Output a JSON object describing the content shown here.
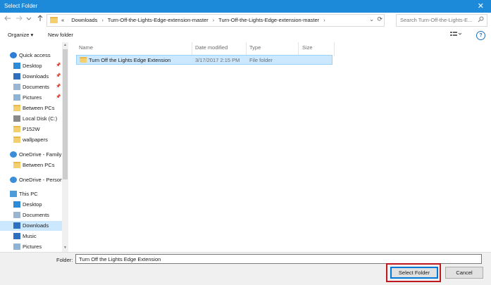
{
  "window": {
    "title": "Select Folder",
    "close_glyph": "✕"
  },
  "nav": {
    "back_icon": "arrow-left-icon",
    "forward_icon": "arrow-right-icon",
    "recent_icon": "chevron-down-icon",
    "up_icon": "arrow-up-icon"
  },
  "address": {
    "overflow": "«",
    "crumbs": [
      "Downloads",
      "Turn-Off-the-Lights-Edge-extension-master",
      "Turn-Off-the-Lights-Edge-extension-master"
    ],
    "separator": "›"
  },
  "search": {
    "placeholder": "Search Turn-Off-the-Lights-E..."
  },
  "toolbar": {
    "organize": "Organize ▾",
    "new_folder": "New folder",
    "view_icon": "view-options-icon",
    "help": "?"
  },
  "sidebar": {
    "items": [
      {
        "label": "Quick access",
        "icon": "star-icon",
        "color": "#2c7ed6",
        "pinned": false
      },
      {
        "label": "Desktop",
        "icon": "desktop-icon",
        "color": "#2e8bd7",
        "pinned": true
      },
      {
        "label": "Downloads",
        "icon": "download-icon",
        "color": "#2e6fc0",
        "pinned": true
      },
      {
        "label": "Documents",
        "icon": "documents-icon",
        "color": "#9bb5d0",
        "pinned": true
      },
      {
        "label": "Pictures",
        "icon": "pictures-icon",
        "color": "#8fb3d3",
        "pinned": true
      },
      {
        "label": "Between PCs",
        "icon": "folder-icon",
        "color": "#f3cf6d",
        "pinned": false
      },
      {
        "label": "Local Disk (C:)",
        "icon": "drive-icon",
        "color": "#8a8a8a",
        "pinned": false
      },
      {
        "label": "P152W",
        "icon": "folder-icon",
        "color": "#f3cf6d",
        "pinned": false
      },
      {
        "label": "wallpapers",
        "icon": "folder-icon",
        "color": "#f3cf6d",
        "pinned": false
      },
      {
        "label": "OneDrive - Family",
        "icon": "onedrive-icon",
        "color": "#3a8ed9",
        "pinned": false
      },
      {
        "label": "Between PCs",
        "icon": "folder-icon",
        "color": "#f3cf6d",
        "pinned": false
      },
      {
        "label": "OneDrive - Person",
        "icon": "onedrive-icon",
        "color": "#3a8ed9",
        "pinned": false
      },
      {
        "label": "This PC",
        "icon": "computer-icon",
        "color": "#4d9bd9",
        "pinned": false
      },
      {
        "label": "Desktop",
        "icon": "desktop-icon",
        "color": "#2e8bd7",
        "pinned": false
      },
      {
        "label": "Documents",
        "icon": "documents-icon",
        "color": "#9bb5d0",
        "pinned": false
      },
      {
        "label": "Downloads",
        "icon": "download-icon",
        "color": "#2e6fc0",
        "pinned": false,
        "selected": true
      },
      {
        "label": "Music",
        "icon": "music-icon",
        "color": "#2e6fc0",
        "pinned": false
      },
      {
        "label": "Pictures",
        "icon": "pictures-icon",
        "color": "#8fb3d3",
        "pinned": false
      }
    ]
  },
  "columns": [
    "Name",
    "Date modified",
    "Type",
    "Size"
  ],
  "files": [
    {
      "name": "Turn Off the Lights Edge Extension",
      "date": "3/17/2017 2:15 PM",
      "type": "File folder",
      "size": ""
    }
  ],
  "footer": {
    "folder_label": "Folder:",
    "folder_value": "Turn Off the Lights Edge Extension",
    "select_button": "Select Folder",
    "cancel_button": "Cancel"
  },
  "colors": {
    "accent": "#1c8ad8",
    "selection": "#cce8ff",
    "highlight": "#c0181f"
  }
}
